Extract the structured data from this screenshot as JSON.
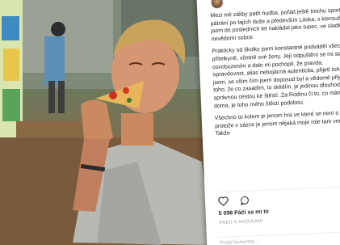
{
  "photo": {
    "subject": "man eating a slice of pizza"
  },
  "post": {
    "avatar_icon": "avatar-icon",
    "caption_paragraphs": [
      "Mezi mé záliby patří hudba, pořád ještě trochu sport, pátrání po tajích duše a především Láska, s kterouž to jsem do posledních let nakládal jako tupec, ve sladkém nevědomí sobce",
      "Prakticky od školky jsem konstantně podváděl všechny přítelkyně, včetně své ženy. Její odpuštění se mi stalo osvobozením a dalo mi pochopit, že pravda, opravdovost, alias nebojácná autenticita, přijetí toho, kdo jsem, se vším čím jsem doposud byl a vědomé přijetí toho, že co zasadím, to sklidím, je jedinou dlouhodobou správnou cestou ke štěstí. Za Rodinu či to, co mám doma, je toho mého štěstí podobou.",
      "Všechno to kolem je jenom hra ve které se není o co bát, protože v sázce je jenom nějaká moje role tam venku. Takže"
    ],
    "actions": {
      "like_icon": "heart-icon",
      "comment_icon": "comment-icon",
      "share_icon": "share-icon"
    },
    "likes": "5 098 Páčí sa mi to",
    "time_ago": "PRED 5 HODINAMI",
    "comment_placeholder": "Pridať komentár..."
  }
}
